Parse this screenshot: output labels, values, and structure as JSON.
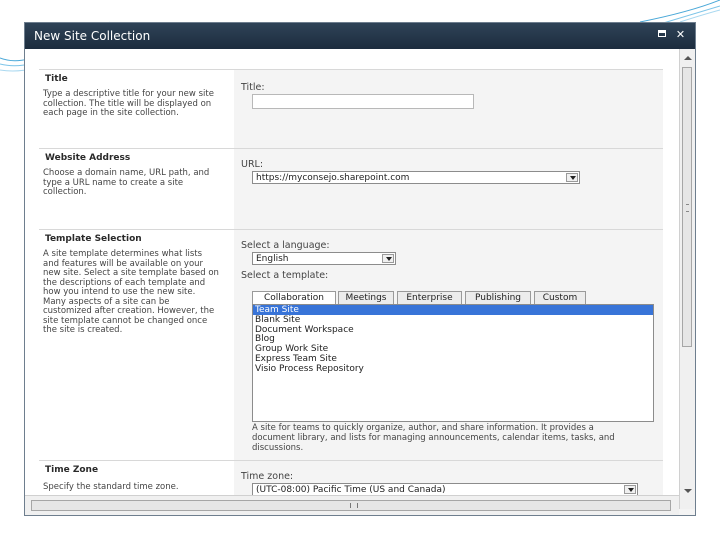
{
  "dialog": {
    "title": "New Site Collection"
  },
  "sections": {
    "title": {
      "heading": "Title",
      "description": "Type a descriptive title for your new site collection. The title will be displayed on each page in the site collection.",
      "field_label": "Title:",
      "value": ""
    },
    "website_address": {
      "heading": "Website Address",
      "description": "Choose a domain name, URL path, and type a URL name to create a site collection.",
      "field_label": "URL:",
      "url_value": "https://myconsejo.sharepoint.com"
    },
    "template_selection": {
      "heading": "Template Selection",
      "description": "A site template determines what lists and features will be available on your new site. Select a site template based on the descriptions of each template and how you intend to use the new site. Many aspects of a site can be customized after creation. However, the site template cannot be changed once the site is created.",
      "language_label": "Select a language:",
      "language_value": "English",
      "template_label": "Select a template:",
      "tabs": [
        "Collaboration",
        "Meetings",
        "Enterprise",
        "Publishing",
        "Custom"
      ],
      "active_tab": "Collaboration",
      "templates": [
        "Team Site",
        "Blank Site",
        "Document Workspace",
        "Blog",
        "Group Work Site",
        "Express Team Site",
        "Visio Process Repository"
      ],
      "selected_template": "Team Site",
      "template_description": "A site for teams to quickly organize, author, and share information. It provides a document library, and lists for managing announcements, calendar items, tasks, and discussions."
    },
    "time_zone": {
      "heading": "Time Zone",
      "description": "Specify the standard time zone.",
      "field_label": "Time zone:",
      "value": "(UTC-08:00) Pacific Time (US and Canada)"
    }
  },
  "colors": {
    "titlebar": "#243649",
    "selection": "#3874d8",
    "section_bg": "#f4f4f4"
  },
  "icons": {
    "maximize": "maximize-icon",
    "close": "close-icon"
  }
}
